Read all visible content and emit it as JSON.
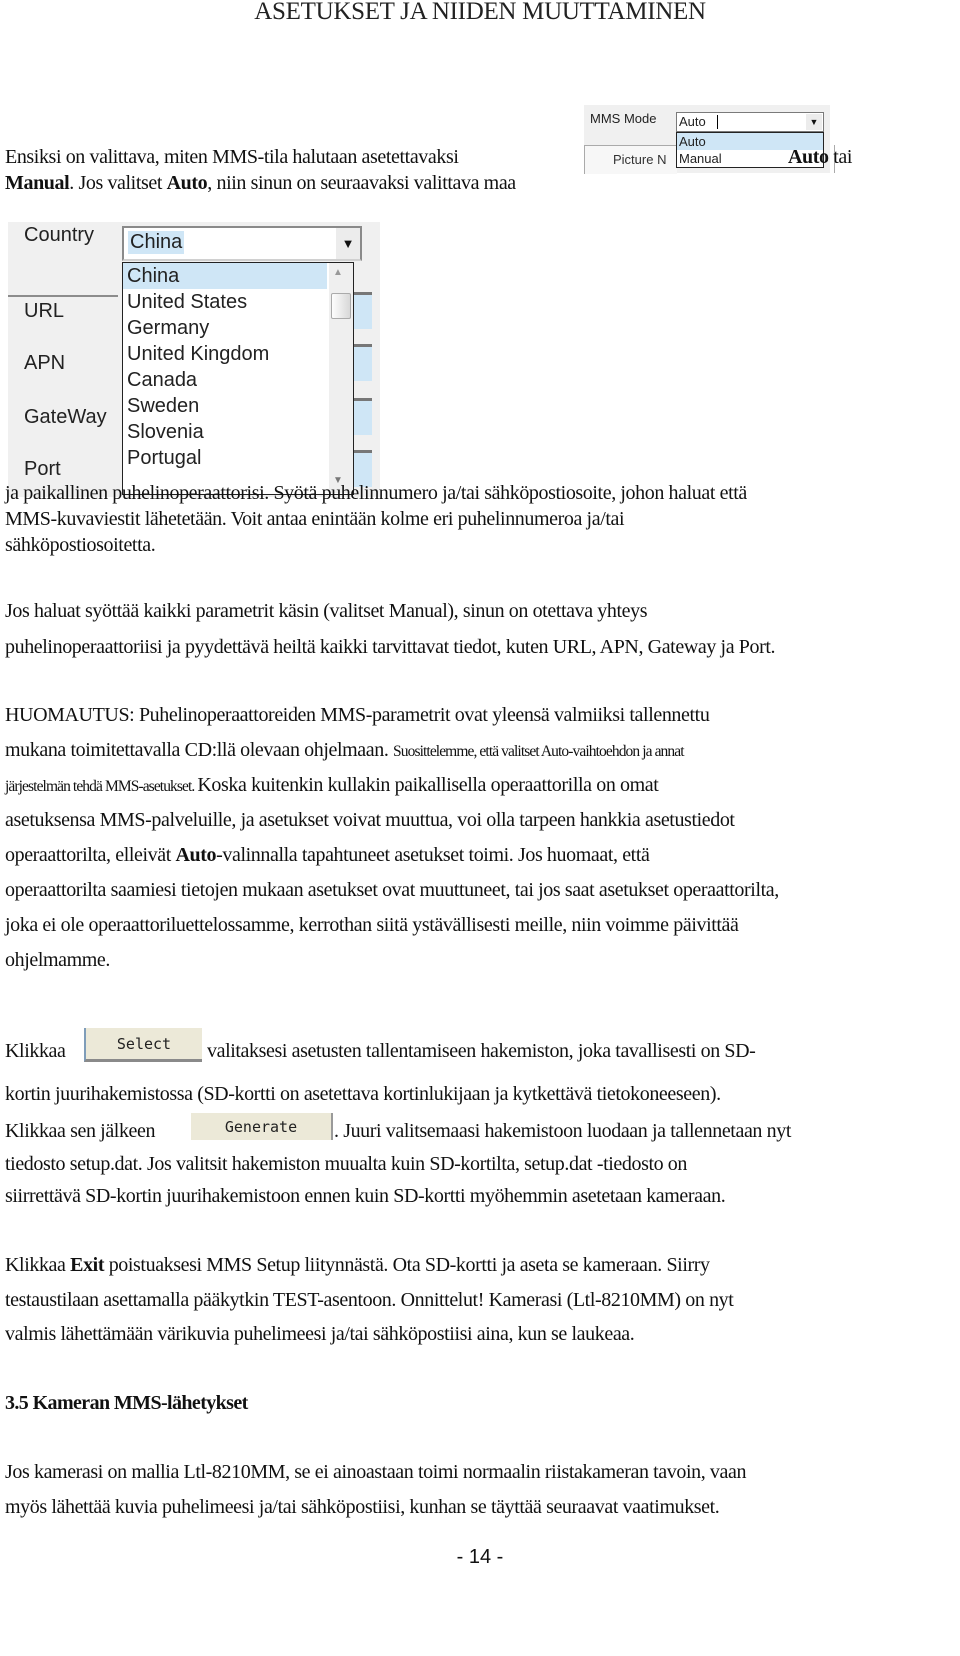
{
  "header": {
    "title": "ASETUKSET JA NIIDEN MUUTTAMINEN"
  },
  "mms_mode_ui": {
    "label": "MMS Mode",
    "value": "Auto",
    "options": [
      "Auto",
      "Manual"
    ],
    "tab_label": "Picture N",
    "selected_color": "#cfe6f6"
  },
  "intro": {
    "line1": "Ensiksi on valittava, miten MMS-tila halutaan asetettavaksi",
    "auto_bold": "Auto",
    "tai": " tai",
    "manual_bold": "Manual",
    "line2_mid": ". Jos valitset ",
    "auto_bold2": "Auto",
    "line2_end": ", niin sinun on seuraavaksi valittava maa"
  },
  "country_ui": {
    "labels": [
      "Country",
      "URL",
      "APN",
      "GateWay",
      "Port"
    ],
    "value": "China",
    "options": [
      "China",
      "United States",
      "Germany",
      "United Kingdom",
      "Canada",
      "Sweden",
      "Slovenia",
      "Portugal"
    ]
  },
  "para1": [
    "ja paikallinen puhelinoperaattorisi. Syötä puhelinnumero ja/tai sähköpostiosoite, johon haluat että",
    "MMS-kuvaviestit lähetetään. Voit antaa enintään kolme eri puhelinnumeroa ja/tai",
    "sähköpostiosoitetta."
  ],
  "para2": [
    "Jos haluat syöttää kaikki parametrit käsin (valitset Manual), sinun on otettava yhteys",
    "puhelinoperaattoriisi ja pyydettävä heiltä kaikki tarvittavat tiedot, kuten URL, APN, Gateway ja Port."
  ],
  "note": {
    "l1": "HUOMAUTUS: Puhelinoperaattoreiden MMS-parametrit ovat yleensä valmiiksi tallennettu",
    "l2a": "mukana toimitettavalla CD:llä olevaan ohjelmaan. ",
    "l2b": "Suosittelemme, että valitset Auto-vaihtoehdon ja annat",
    "l3a": "järjestelmän tehdä MMS-asetukset. ",
    "l3b": "Koska kuitenkin kullakin paikallisella operaattorilla on omat",
    "l4": "asetuksensa MMS-palveluille, ja asetukset voivat muuttua, voi olla tarpeen hankkia asetustiedot",
    "l5a": "operaattorilta, elleivät ",
    "l5bold": "Auto",
    "l5b": "-valinnalla tapahtuneet asetukset toimi. Jos huomaat, että",
    "l6": "operaattorilta saamiesi tietojen mukaan asetukset ovat muuttuneet, tai jos saat asetukset operaattorilta,",
    "l7": "joka ei ole operaattoriluettelossamme, kerrothan siitä ystävällisesti meille, niin voimme päivittää",
    "l8": "ohjelmamme."
  },
  "select_para": {
    "l1a": "Klikkaa ",
    "select_button": "Select",
    "l1b": "valitaksesi asetusten tallentamiseen hakemiston, joka tavallisesti on SD-",
    "l2": "kortin juurihakemistossa (SD-kortti on asetettava kortinlukijaan ja kytkettävä tietokoneeseen).",
    "l3a": "Klikkaa sen jälkeen",
    "generate_button": "Generate",
    "l3b": ". Juuri valitsemaasi hakemistoon luodaan ja tallennetaan nyt",
    "l4": "tiedosto setup.dat. Jos valitsit hakemiston muualta kuin SD-kortilta, setup.dat -tiedosto on",
    "l5": "siirrettävä SD-kortin juurihakemistoon ennen kuin SD-kortti myöhemmin asetetaan kameraan."
  },
  "exit_para": {
    "l1a": "Klikkaa ",
    "exit_bold": "Exit",
    "l1b": " poistuaksesi MMS Setup liitynnästä. Ota SD-kortti ja aseta se kameraan. Siirry",
    "l2": "testaustilaan asettamalla pääkytkin TEST-asentoon. Onnittelut! Kamerasi (Ltl-8210MM) on nyt",
    "l3": "valmis lähettämään värikuvia puhelimeesi ja/tai sähköpostiisi aina, kun se laukeaa."
  },
  "section": {
    "heading": "3.5  Kameran MMS-lähetykset",
    "l1": "Jos kamerasi on mallia Ltl-8210MM, se ei ainoastaan toimi normaalin riistakameran tavoin, vaan",
    "l2": "myös lähettää kuvia puhelimeesi ja/tai sähköpostiisi, kunhan se täyttää seuraavat vaatimukset."
  },
  "footer": {
    "page_number": "- 14 -"
  }
}
